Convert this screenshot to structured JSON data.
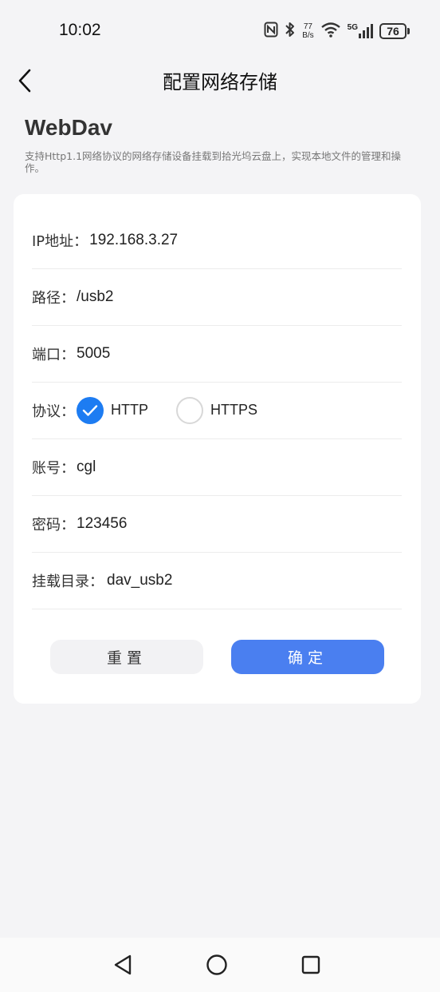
{
  "status_bar": {
    "time": "10:02",
    "net_speed_value": "77",
    "net_speed_unit": "B/s",
    "signal_label": "5G",
    "battery_level": "76"
  },
  "header": {
    "title": "配置网络存储"
  },
  "section": {
    "title": "WebDav",
    "description": "支持Http1.1网络协议的网络存储设备挂载到拾光坞云盘上，实现本地文件的管理和操作。"
  },
  "form": {
    "ip": {
      "label": "IP地址：",
      "value": "192.168.3.27"
    },
    "path": {
      "label": "路径：",
      "value": "/usb2"
    },
    "port": {
      "label": "端口：",
      "value": "5005"
    },
    "protocol": {
      "label": "协议：",
      "options": [
        {
          "label": "HTTP",
          "selected": true
        },
        {
          "label": "HTTPS",
          "selected": false
        }
      ]
    },
    "account": {
      "label": "账号：",
      "value": "cgl"
    },
    "password": {
      "label": "密码：",
      "value": "123456"
    },
    "mount_dir": {
      "label": "挂载目录：",
      "value": "dav_usb2"
    }
  },
  "buttons": {
    "reset_label": "重置",
    "confirm_label": "确定"
  },
  "colors": {
    "accent": "#4a7ff0",
    "radio_checked": "#1d7cf2",
    "background": "#f4f4f6"
  }
}
